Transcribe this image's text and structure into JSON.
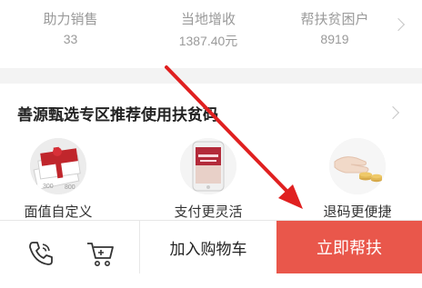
{
  "stats": [
    {
      "label": "助力销售",
      "value": "33"
    },
    {
      "label": "当地增收",
      "value": "1387.40元"
    },
    {
      "label": "帮扶贫困户",
      "value": "8919"
    }
  ],
  "section": {
    "title": "善源甄选专区推荐使用扶贫码",
    "features": [
      {
        "label": "面值自定义",
        "icon": "gift-card-icon"
      },
      {
        "label": "支付更灵活",
        "icon": "phone-shopping-icon"
      },
      {
        "label": "退码更便捷",
        "icon": "hand-coins-icon"
      }
    ]
  },
  "bottom_bar": {
    "add_to_cart": "加入购物车",
    "help_now": "立即帮扶"
  },
  "colors": {
    "accent": "#e9574b",
    "arrow": "#e02020",
    "muted_text": "#9a9a9a"
  }
}
